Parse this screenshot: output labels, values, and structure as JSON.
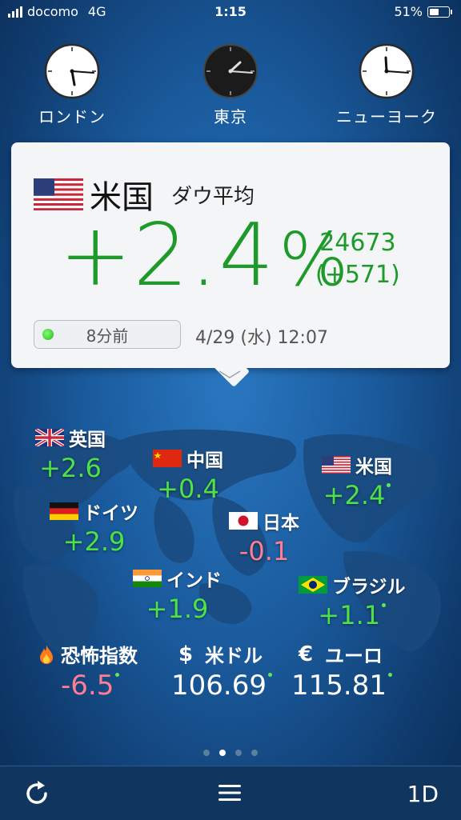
{
  "status": {
    "carrier": "docomo",
    "network": "4G",
    "time": "1:15",
    "battery": "51%",
    "battery_level": 0.51
  },
  "clocks": [
    {
      "label": "ロンドン",
      "theme": "light"
    },
    {
      "label": "東京",
      "theme": "dark"
    },
    {
      "label": "ニューヨーク",
      "theme": "light"
    }
  ],
  "card": {
    "country": "米国",
    "index_name": "ダウ平均",
    "change_pct": "+2.4",
    "pct_sign": "%",
    "value": "24673",
    "change": "(+571)",
    "updated": "8分前",
    "timestamp": "4/29 (水) 12:07",
    "color": "#1d9a2a"
  },
  "markets": {
    "uk": {
      "name": "英国",
      "value": "+2.6",
      "flag": "uk-flag"
    },
    "china": {
      "name": "中国",
      "value": "+0.4",
      "flag": "china-flag"
    },
    "us": {
      "name": "米国",
      "value": "+2.4",
      "flag": "us-flag"
    },
    "germany": {
      "name": "ドイツ",
      "value": "+2.9",
      "flag": "germany-flag"
    },
    "japan": {
      "name": "日本",
      "value": "-0.1",
      "flag": "japan-flag"
    },
    "india": {
      "name": "インド",
      "value": "+1.9",
      "flag": "india-flag"
    },
    "brazil": {
      "name": "ブラジル",
      "value": "+1.1",
      "flag": "brazil-flag"
    }
  },
  "stats": {
    "fear": {
      "icon": "flame-icon",
      "name": "恐怖指数",
      "value": "-6.5"
    },
    "usd": {
      "symbol": "$",
      "name": "米ドル",
      "value": "106.69"
    },
    "eur": {
      "symbol": "€",
      "name": "ユーロ",
      "value": "115.81"
    }
  },
  "pager": {
    "count": 4,
    "active": 1
  },
  "toolbar": {
    "refresh_icon": "refresh-icon",
    "menu_icon": "menu-icon",
    "range": "1D"
  },
  "colors": {
    "up": "#4ee14a",
    "down": "#ff7e93",
    "card_green": "#1d9a2a"
  }
}
